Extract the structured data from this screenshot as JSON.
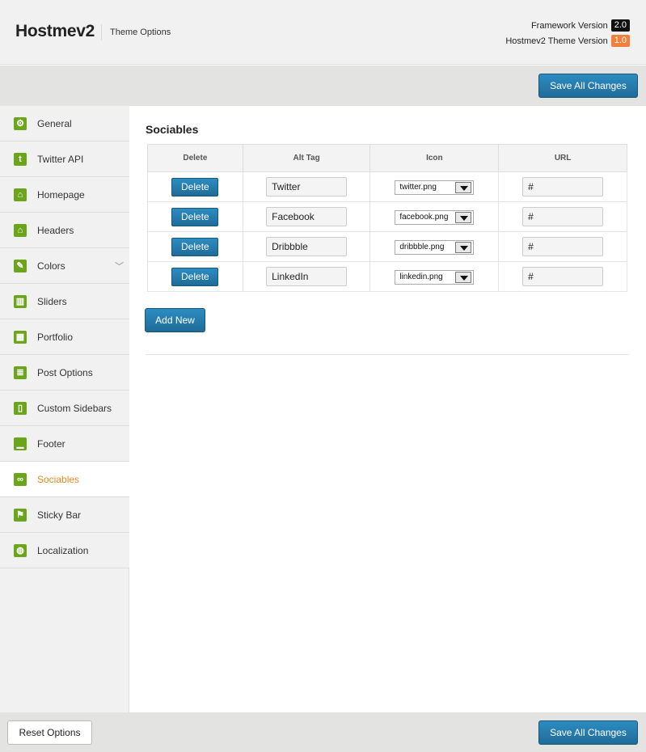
{
  "header": {
    "brand": "Hostmev2",
    "subtitle": "Theme Options",
    "framework_label": "Framework Version",
    "framework_version": "2.0",
    "theme_label": "Hostmev2 Theme Version",
    "theme_version": "1.0"
  },
  "toolbar": {
    "save_label": "Save All Changes"
  },
  "sidebar": {
    "items": [
      {
        "label": "General",
        "icon": "gear-icon"
      },
      {
        "label": "Twitter API",
        "icon": "twitter-icon"
      },
      {
        "label": "Homepage",
        "icon": "home-icon"
      },
      {
        "label": "Headers",
        "icon": "home-icon"
      },
      {
        "label": "Colors",
        "icon": "brush-icon"
      },
      {
        "label": "Sliders",
        "icon": "slider-icon"
      },
      {
        "label": "Portfolio",
        "icon": "grid-icon"
      },
      {
        "label": "Post Options",
        "icon": "document-icon"
      },
      {
        "label": "Custom Sidebars",
        "icon": "sidebar-icon"
      },
      {
        "label": "Footer",
        "icon": "footer-icon"
      },
      {
        "label": "Sociables",
        "icon": "link-icon"
      },
      {
        "label": "Sticky Bar",
        "icon": "flag-icon"
      },
      {
        "label": "Localization",
        "icon": "globe-icon"
      }
    ],
    "active": "Sociables"
  },
  "main": {
    "title": "Sociables",
    "columns": [
      "Delete",
      "Alt Tag",
      "Icon",
      "URL"
    ],
    "delete_label": "Delete",
    "rows": [
      {
        "alt": "Twitter",
        "icon": "twitter.png",
        "url": "#"
      },
      {
        "alt": "Facebook",
        "icon": "facebook.png",
        "url": "#"
      },
      {
        "alt": "Dribbble",
        "icon": "dribbble.png",
        "url": "#"
      },
      {
        "alt": "LinkedIn",
        "icon": "linkedin.png",
        "url": "#"
      }
    ],
    "add_new_label": "Add New"
  },
  "footer": {
    "reset_label": "Reset Options",
    "save_label": "Save All Changes"
  },
  "colors": {
    "accent_blue": "#1f6c98",
    "active_orange": "#e8891e",
    "icon_green": "#6aa51a"
  }
}
